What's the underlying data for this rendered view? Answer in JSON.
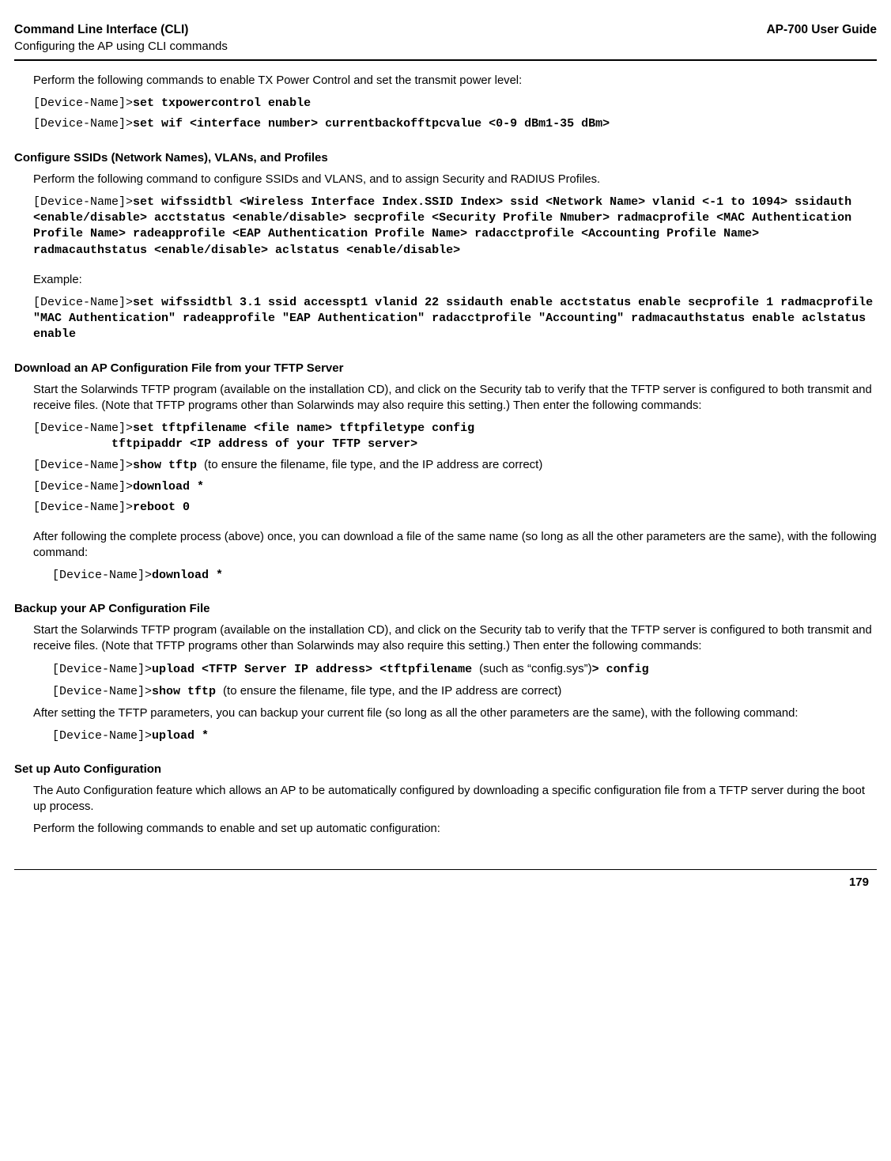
{
  "header": {
    "title": "Command Line Interface (CLI)",
    "subtitle": "Configuring the AP using CLI commands",
    "guide": "AP-700 User Guide"
  },
  "s1": {
    "p1": "Perform the following commands to enable TX Power Control and set the transmit power level:",
    "c1p": "[Device-Name]>",
    "c1c": "set txpowercontrol enable",
    "c2p": "[Device-Name]>",
    "c2c": "set wif <interface number> currentbackofftpcvalue <0-9 dBm1-35 dBm>"
  },
  "s2": {
    "h": "Configure SSIDs (Network Names), VLANs, and Profiles",
    "p1": "Perform the following command to configure SSIDs and VLANS, and to assign Security and RADIUS Profiles.",
    "c1p": "[Device-Name]>",
    "c1c": "set wifssidtbl <Wireless Interface Index.SSID Index> ssid <Network Name> vlanid <-1 to 1094> ssidauth <enable/disable> acctstatus <enable/disable> secprofile <Security Profile Nmuber> radmacprofile <MAC Authentication Profile Name> radeapprofile <EAP Authentication Profile Name> radacctprofile <Accounting Profile Name> radmacauthstatus <enable/disable> aclstatus <enable/disable>",
    "p2": "Example:",
    "c2p": "[Device-Name]>",
    "c2c": "set wifssidtbl 3.1 ssid accesspt1 vlanid 22 ssidauth enable acctstatus enable secprofile 1 radmacprofile \"MAC Authentication\" radeapprofile \"EAP Authentication\" radacctprofile \"Accounting\" radmacauthstatus enable aclstatus enable"
  },
  "s3": {
    "h": "Download an AP Configuration File from your TFTP Server",
    "p1": "Start the Solarwinds TFTP program (available on the installation CD), and click on the Security tab to verify that the TFTP server is configured to both transmit and receive files. (Note that TFTP programs other than Solarwinds may also require this setting.) Then enter the following commands:",
    "c1p": "[Device-Name]>",
    "c1c": "set tftpfilename <file name> tftpfiletype config",
    "c1b": "           tftpipaddr <IP address of your TFTP server>",
    "c2p": "[Device-Name]>",
    "c2c": "show tftp ",
    "c2n": "(to ensure the filename, file type, and the IP address are correct)",
    "c3p": "[Device-Name]>",
    "c3c": "download *",
    "c4p": "[Device-Name]>",
    "c4c": "reboot 0",
    "p2": "After following the complete process (above) once, you can download a file of the same name (so long as all the other parameters are the same), with the following command:",
    "c5p": "[Device-Name]>",
    "c5c": "download *"
  },
  "s4": {
    "h": "Backup your AP Configuration File",
    "p1": "Start the Solarwinds TFTP program (available on the installation CD), and click on the Security tab to verify that the TFTP server is configured to both transmit and receive files. (Note that TFTP programs other than Solarwinds may also require this setting.) Then enter the following commands:",
    "c1p": "[Device-Name]>",
    "c1c": "upload <TFTP Server IP address> <tftpfilename ",
    "c1n": "(such as “config.sys”)",
    "c1d": "> config",
    "c2p": "[Device-Name]>",
    "c2c": "show tftp ",
    "c2n": "(to ensure the filename, file type, and the IP address are correct)",
    "p2": "After setting the TFTP parameters, you can backup your current file (so long as all the other parameters are the same), with the following command:",
    "c3p": "[Device-Name]>",
    "c3c": "upload *"
  },
  "s5": {
    "h": "Set up Auto Configuration",
    "p1": "The Auto Configuration feature which allows an AP to be automatically configured by downloading a specific configuration file from a TFTP server during the boot up process.",
    "p2": "Perform the following commands to enable and set up automatic configuration:"
  },
  "footer": {
    "page": "179"
  }
}
